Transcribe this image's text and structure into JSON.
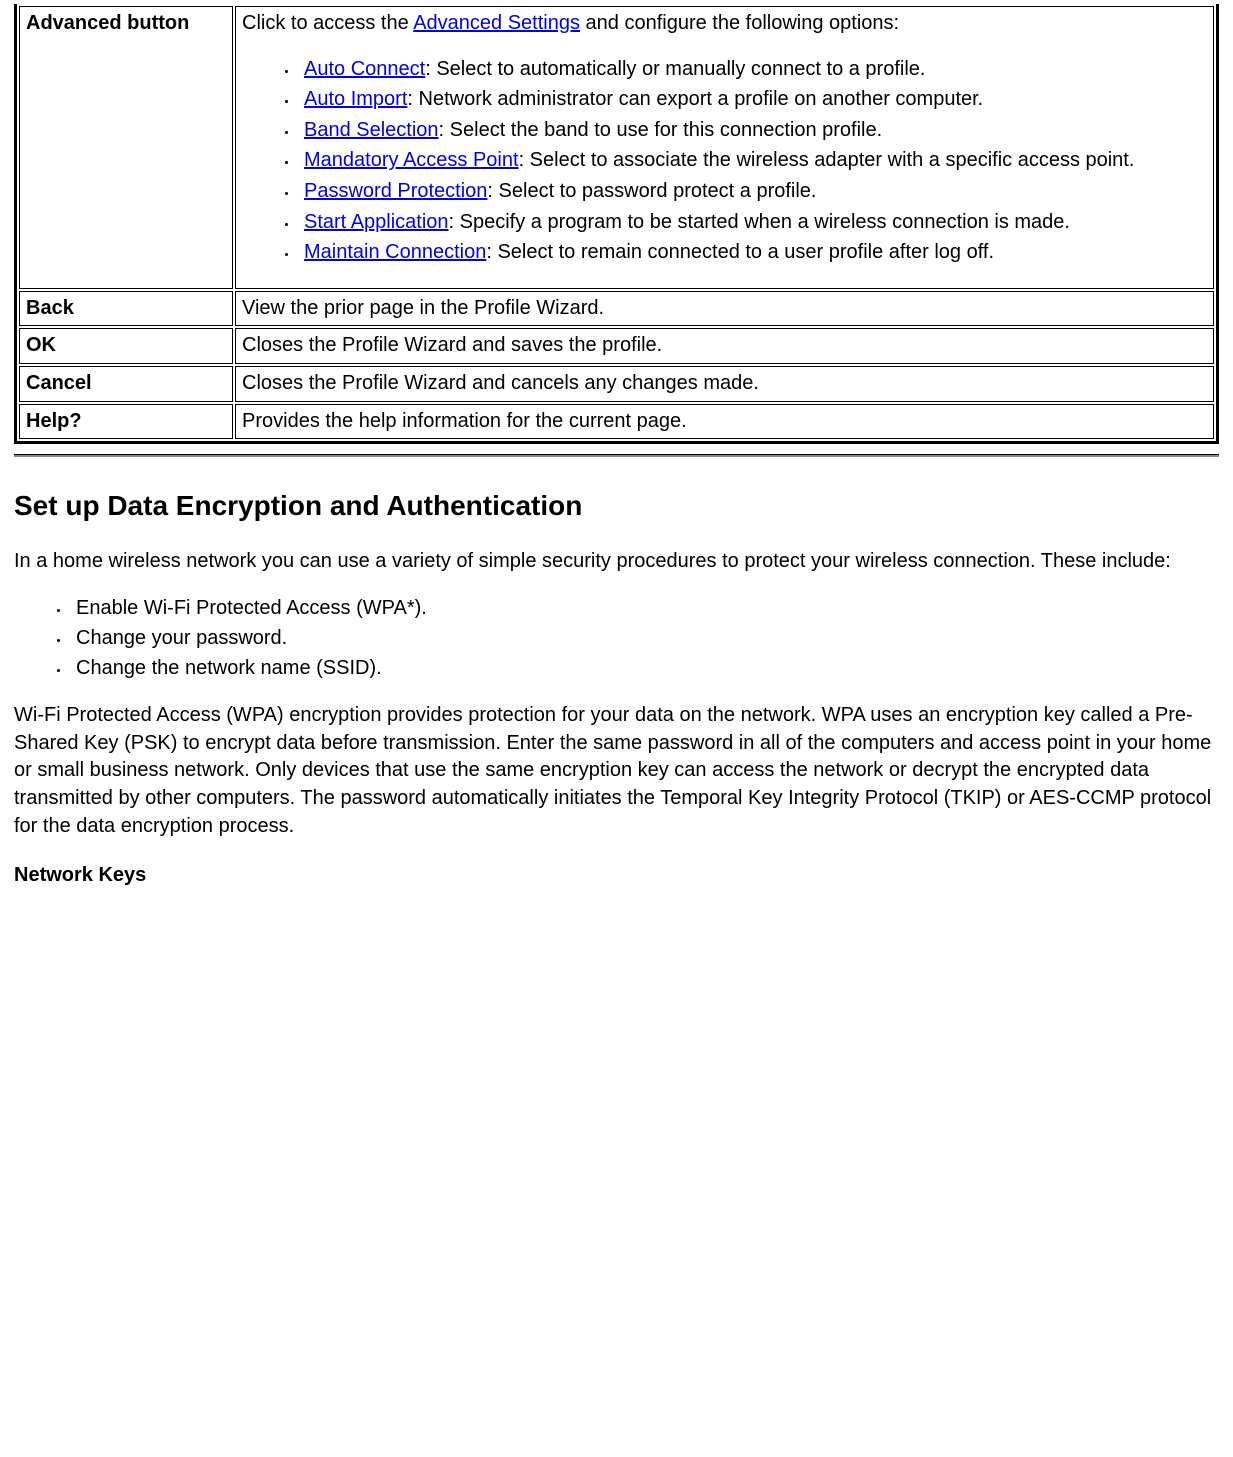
{
  "table": {
    "rows": [
      {
        "label": "Advanced button",
        "intro_pre": "Click to access the ",
        "intro_link": "Advanced Settings",
        "intro_post": " and configure the following options:",
        "options": [
          {
            "link": "Auto Connect",
            "desc": ": Select to automatically or manually connect to a profile."
          },
          {
            "link": "Auto Import",
            "desc": ": Network administrator can export a profile on another computer."
          },
          {
            "link": "Band Selection",
            "desc": ": Select the band to use for this connection profile."
          },
          {
            "link": "Mandatory Access Point",
            "desc": ": Select to associate the wireless adapter with a specific access point."
          },
          {
            "link": "Password Protection",
            "desc": ": Select to password protect a profile."
          },
          {
            "link": "Start Application",
            "desc": ": Specify a program to be started when a wireless connection is made."
          },
          {
            "link": "Maintain Connection",
            "desc": ": Select to remain connected to a user profile after log off."
          }
        ]
      },
      {
        "label": "Back",
        "text": "View the prior page in the Profile Wizard."
      },
      {
        "label": "OK",
        "text": "Closes the Profile Wizard and saves the profile."
      },
      {
        "label": "Cancel",
        "text": "Closes the Profile Wizard and cancels any changes made."
      },
      {
        "label": "Help?",
        "text": "Provides the help information for the current page."
      }
    ]
  },
  "section": {
    "heading": "Set up Data Encryption and Authentication",
    "p1": "In a home wireless network you can use a variety of simple security procedures to protect your wireless connection. These include:",
    "bullets": [
      "Enable Wi-Fi Protected Access (WPA*).",
      "Change your password.",
      "Change the network name (SSID)."
    ],
    "p2": "Wi-Fi Protected Access (WPA) encryption provides protection for your data on the network. WPA uses an encryption key called a Pre-Shared Key (PSK) to encrypt data before transmission. Enter the same password in all of the computers and access point in your home or small business network. Only devices that use the same encryption key can access the network or decrypt the encrypted data transmitted by other computers. The password automatically initiates the Temporal Key Integrity Protocol (TKIP) or AES-CCMP protocol for the data encryption process.",
    "subheading": "Network Keys"
  }
}
